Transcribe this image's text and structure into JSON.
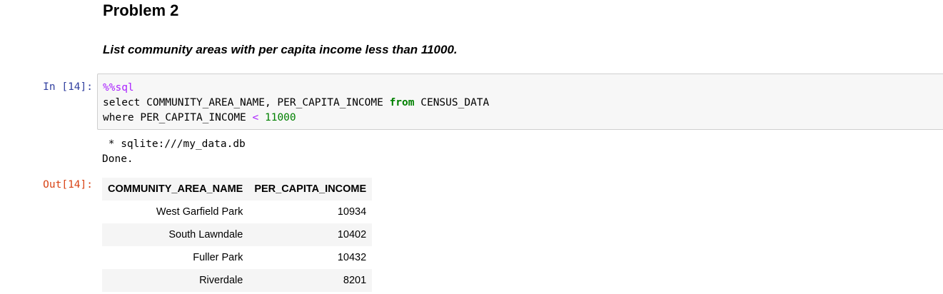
{
  "heading": "Problem 2",
  "question": "List community areas with per capita income less than 11000.",
  "input_cell": {
    "prompt": "In [14]:",
    "code": {
      "magic": "%%sql",
      "line2_a": "select COMMUNITY_AREA_NAME, PER_CAPITA_INCOME ",
      "line2_kw": "from",
      "line2_b": " CENSUS_DATA",
      "line3_a": "where PER_CAPITA_INCOME ",
      "line3_op": "<",
      "line3_sp": " ",
      "line3_num": "11000"
    }
  },
  "output": {
    "stdout_line1": " * sqlite:///my_data.db",
    "stdout_line2": "Done.",
    "prompt": "Out[14]:",
    "table": {
      "columns": [
        "COMMUNITY_AREA_NAME",
        "PER_CAPITA_INCOME"
      ],
      "rows": [
        [
          "West Garfield Park",
          "10934"
        ],
        [
          "South Lawndale",
          "10402"
        ],
        [
          "Fuller Park",
          "10432"
        ],
        [
          "Riverdale",
          "8201"
        ]
      ]
    }
  }
}
